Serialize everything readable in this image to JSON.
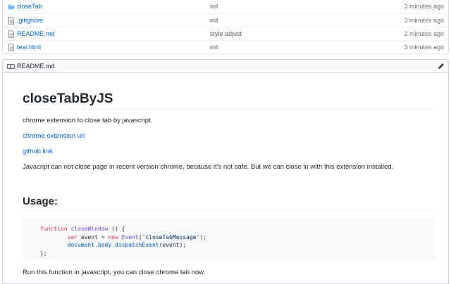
{
  "files": [
    {
      "name": "closeTab",
      "type": "folder",
      "message": "init",
      "age": "3 minutes ago"
    },
    {
      "name": ".gitignore",
      "type": "file",
      "message": "init",
      "age": "3 minutes ago"
    },
    {
      "name": "README.md",
      "type": "file",
      "message": "style adjust",
      "age": "2 minutes ago"
    },
    {
      "name": "test.html",
      "type": "file",
      "message": "init",
      "age": "3 minutes ago"
    }
  ],
  "readme": {
    "header_label": "README.md",
    "title": "closeTabByJS",
    "description": "chrome extension to close tab by javascript.",
    "link_extension": "chrome extension url",
    "link_github": "github link",
    "paragraph": "Javacript can not close page in recent version chrome, because it's not safe. But we can close in with this extension installed.",
    "usage_heading": "Usage:",
    "code": {
      "line1_kw": "function",
      "line1_fn": "closeWindow",
      "line1_rest": " () {",
      "line2_kw1": "var",
      "line2_mid": " event = ",
      "line2_kw2": "new",
      "line2_fn": "Event",
      "line2_str": "'closeTabMessage'",
      "line2_end": ");",
      "line3_obj": "document.body.dispatchEvent",
      "line3_rest": "(event);",
      "line4": "};"
    },
    "footer_text": "Run this function in javascript, you can close chrome tab now."
  },
  "colors": {
    "link": "#0366d6",
    "keyword": "#d73a49",
    "function": "#6f42c1",
    "string": "#032f62"
  },
  "icons": {
    "folder": "folder-icon",
    "file": "file-text-icon",
    "readme": "book-icon",
    "edit": "pencil-icon"
  }
}
